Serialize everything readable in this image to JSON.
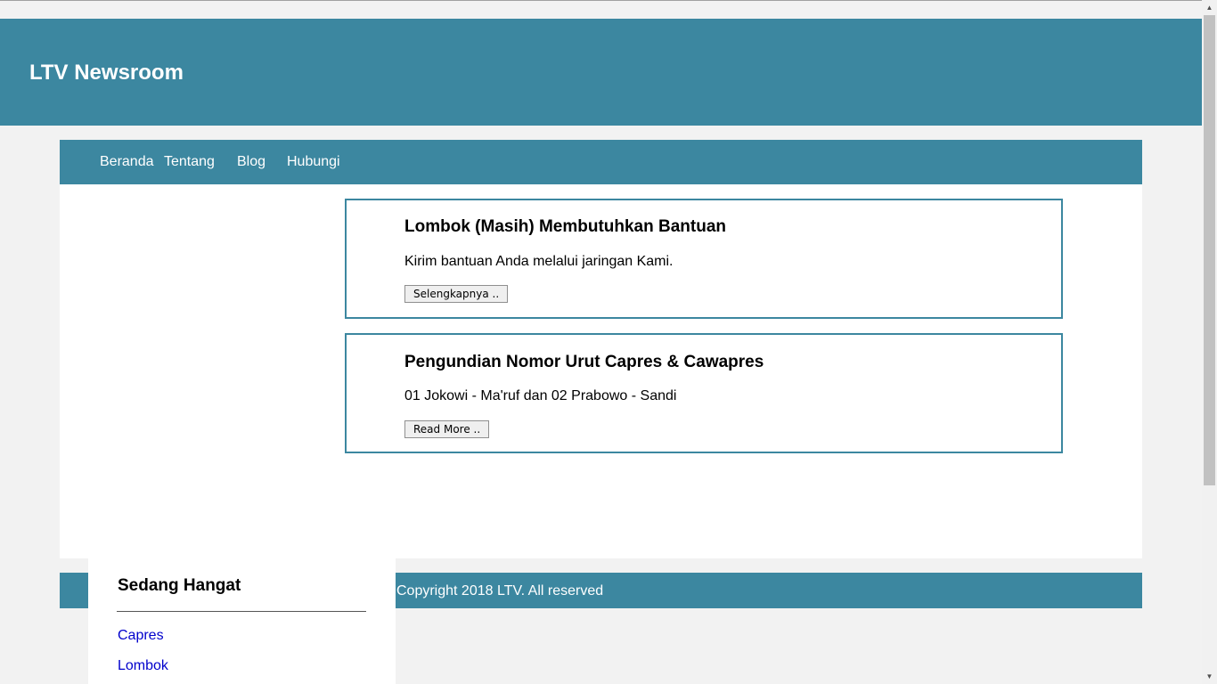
{
  "header": {
    "title": "LTV Newsroom"
  },
  "nav": {
    "items": [
      {
        "label": "Beranda"
      },
      {
        "label": "Tentang"
      },
      {
        "label": "Blog"
      },
      {
        "label": "Hubungi"
      }
    ]
  },
  "posts": [
    {
      "title": "Lombok (Masih) Membutuhkan Bantuan",
      "text": "Kirim bantuan Anda melalui jaringan Kami.",
      "button_label": "Selengkapnya .."
    },
    {
      "title": "Pengundian Nomor Urut Capres & Cawapres",
      "text": "01 Jokowi - Ma'ruf dan 02 Prabowo - Sandi",
      "button_label": "Read More .."
    }
  ],
  "footer": {
    "text": "Copyright 2018 LTV. All reserved"
  },
  "sidebar": {
    "title": "Sedang Hangat",
    "links": [
      {
        "label": "Capres"
      },
      {
        "label": "Lombok"
      }
    ]
  },
  "colors": {
    "brand": "#3c87a0",
    "link": "#0000cc",
    "background": "#f2f2f2"
  },
  "icons": {
    "scroll_up": "triangle-up-icon",
    "scroll_down": "triangle-down-icon"
  }
}
